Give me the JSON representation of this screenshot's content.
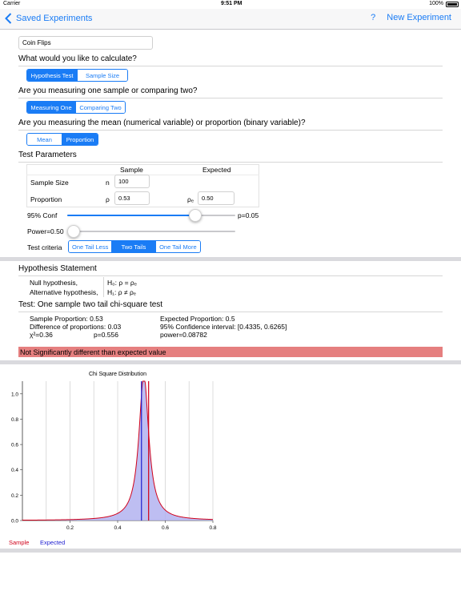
{
  "status_bar": {
    "carrier": "Carrier",
    "time": "9:51 PM",
    "battery": "100%"
  },
  "nav": {
    "back_label": "Saved Experiments",
    "help_label": "?",
    "new_label": "New Experiment"
  },
  "experiment_name": "Coin Flips",
  "q_calculate": "What would you like to calculate?",
  "calc_segments": [
    "Hypothesis Test",
    "Sample Size"
  ],
  "q_measuring": "Are you measuring one sample or comparing two?",
  "measure_segments": [
    "Measuring One",
    "Comparing Two"
  ],
  "q_mean_prop": "Are you measuring the mean (numerical variable) or proportion (binary variable)?",
  "meanprop_segments": [
    "Mean",
    "Proportion"
  ],
  "test_params": {
    "title": "Test Parameters",
    "col_sample": "Sample",
    "col_expected": "Expected",
    "sample_size_label": "Sample Size",
    "n_symbol": "n",
    "n_value": "100",
    "proportion_label": "Proportion",
    "rho_symbol": "ρ",
    "rho_value": "0.53",
    "rho_e_symbol": "ρₑ",
    "rho_e_value": "0.50"
  },
  "conf_slider": {
    "label": "95% Conf",
    "value_label": "p=0.05",
    "level": 0.76
  },
  "power_slider": {
    "label": "Power=0.50",
    "level": 0.0
  },
  "criteria": {
    "label": "Test criteria",
    "options": [
      "One Tail Less",
      "Two Tails",
      "One Tail More"
    ]
  },
  "hypothesis": {
    "title": "Hypothesis Statement",
    "null_label": "Null hypothesis,",
    "null_value": "H₀: ρ = ρₑ",
    "alt_label": "Alternative hypothesis,",
    "alt_value": "H₁: ρ ≠ ρₑ"
  },
  "test": {
    "title": "Test: One sample two tail chi-square test",
    "sample_prop": "Sample Proportion: 0.53",
    "expected_prop": "Expected Proportion: 0.5",
    "diff": "Difference of proportions: 0.03",
    "ci": "95% Confidence interval: [0.4335, 0.6265]",
    "chi": "χ²=0.36",
    "p": "p=0.556",
    "power": "power=0.08782"
  },
  "result_banner": "Not Significantly different than expected value",
  "colors": {
    "accent": "#1a7cf5",
    "banner": "#e57f7f",
    "sample_line": "#d0021b",
    "expected_line": "#1f1fd0",
    "fill": "#b3b3f0"
  },
  "chart_data": {
    "type": "area",
    "title": "Chi Square Distribution",
    "xlim": [
      0,
      0.8
    ],
    "ylim": [
      0,
      1.1
    ],
    "x_ticks": [
      "0.2",
      "0.4",
      "0.6",
      "0.8"
    ],
    "y_ticks": [
      "0.0",
      "0.2",
      "0.4",
      "0.6",
      "0.8",
      "1.0"
    ],
    "sample_value": 0.53,
    "expected_value": 0.5,
    "curve_center": 0.51,
    "curve_scale": 0.025,
    "legend": [
      {
        "name": "Sample"
      },
      {
        "name": "Expected"
      }
    ]
  }
}
